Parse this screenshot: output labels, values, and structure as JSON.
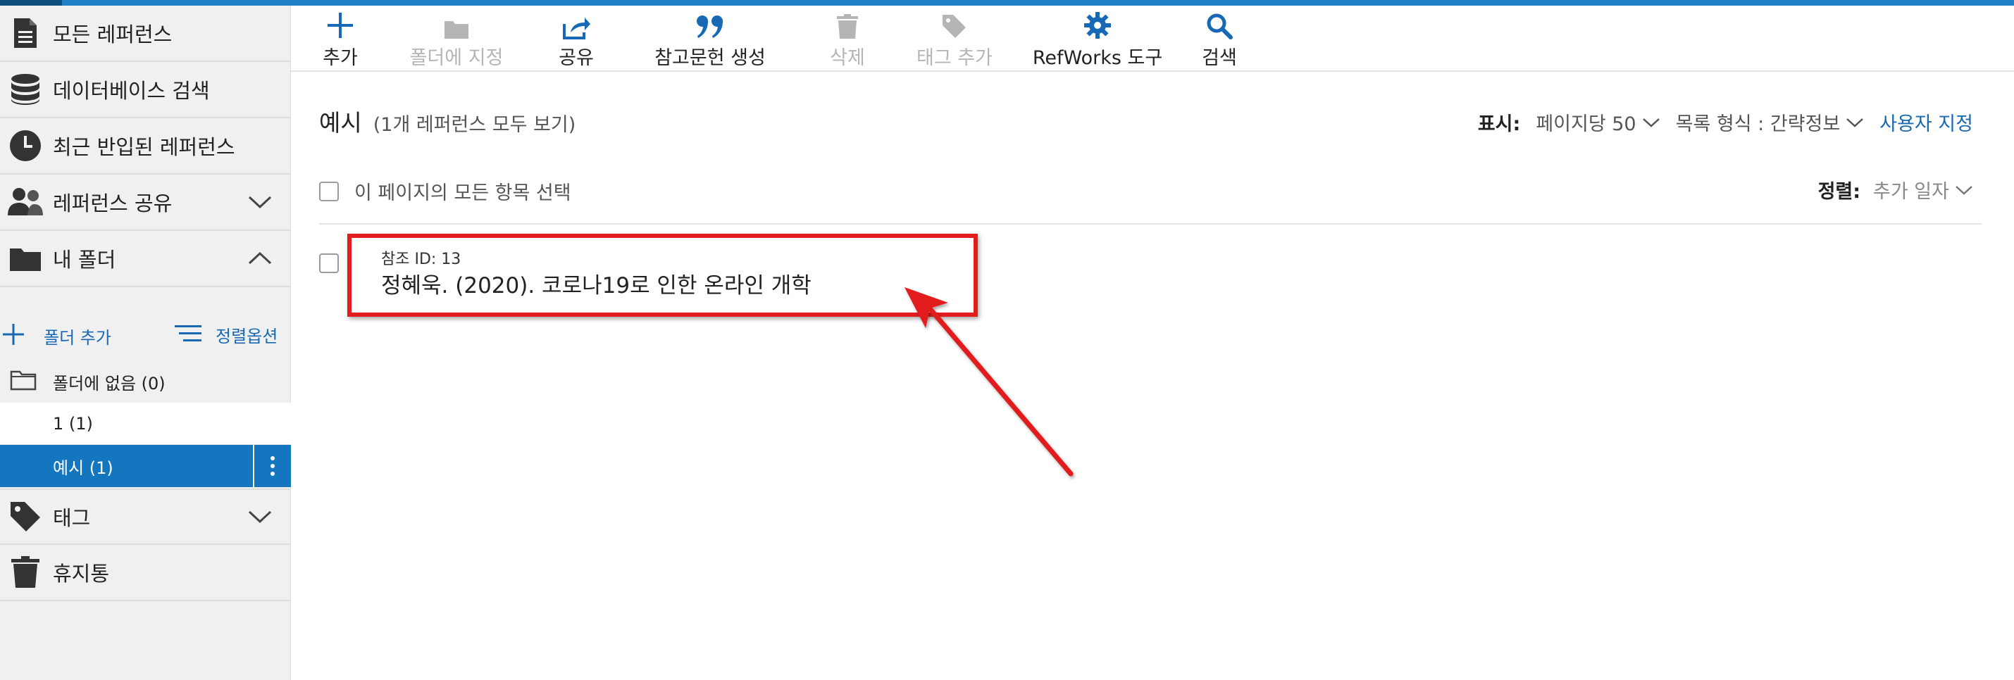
{
  "colors": {
    "accent": "#1f7fc4",
    "active_row": "#1576c0",
    "link": "#1769b5",
    "annotation": "#e21d1d"
  },
  "sidebar": {
    "items": [
      {
        "label": "모든 레퍼런스",
        "icon": "document-icon"
      },
      {
        "label": "데이터베이스 검색",
        "icon": "database-icon"
      },
      {
        "label": "최근 반입된 레퍼런스",
        "icon": "clock-icon"
      },
      {
        "label": "레퍼런스 공유",
        "icon": "users-icon",
        "expandable": true,
        "expanded": false
      },
      {
        "label": "내 폴더",
        "icon": "folder-icon",
        "expandable": true,
        "expanded": true
      }
    ],
    "folder_tools": {
      "add_label": "폴더 추가",
      "sort_label": "정렬옵션"
    },
    "folders": [
      {
        "label": "폴더에 없음 (0)"
      },
      {
        "label": "1 (1)"
      },
      {
        "label": "예시 (1)",
        "active": true
      }
    ],
    "bottom_items": [
      {
        "label": "태그",
        "icon": "tag-icon",
        "expandable": true
      },
      {
        "label": "휴지통",
        "icon": "trash-icon"
      }
    ]
  },
  "toolbar": {
    "items": [
      {
        "label": "추가",
        "icon": "plus-icon",
        "enabled": true
      },
      {
        "label": "폴더에 지정",
        "icon": "folder-icon",
        "enabled": false
      },
      {
        "label": "공유",
        "icon": "share-icon",
        "enabled": true
      },
      {
        "label": "참고문헌 생성",
        "icon": "quote-icon",
        "enabled": true
      },
      {
        "label": "삭제",
        "icon": "trash-icon",
        "enabled": false
      },
      {
        "label": "태그 추가",
        "icon": "tag-icon",
        "enabled": false
      },
      {
        "label": "RefWorks 도구",
        "icon": "gear-icon",
        "enabled": true
      },
      {
        "label": "검색",
        "icon": "search-icon",
        "enabled": true
      }
    ]
  },
  "main": {
    "title": "예시",
    "subtitle": "(1개 레퍼런스 모두 보기)",
    "display": {
      "label": "표시:",
      "per_page": "페이지당 50",
      "list_format": "목록 형식 : 간략정보",
      "customize": "사용자 지정"
    },
    "select_all_label": "이 페이지의 모든 항목 선택",
    "sort": {
      "label": "정렬:",
      "value": "추가 일자"
    },
    "references": [
      {
        "ref_id": "참조 ID: 13",
        "citation": "정혜욱. (2020). 코로나19로 인한 온라인 개학"
      }
    ]
  }
}
